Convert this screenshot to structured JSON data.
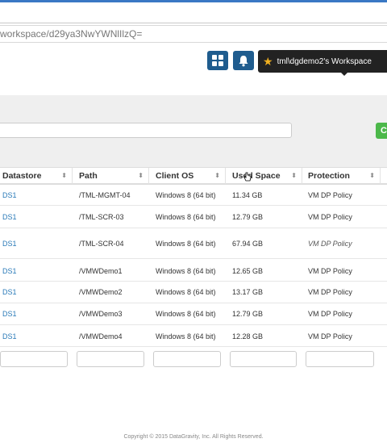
{
  "browser": {
    "url": "workspace/d29ya3NwYWNlIlzQ="
  },
  "header": {
    "workspace_label": "tml\\dgdemo2's Workspace",
    "icons": [
      "grid-icon",
      "bell-icon",
      "star-icon"
    ]
  },
  "toolbar": {
    "green_button_label": "C"
  },
  "table": {
    "columns": [
      "Datastore",
      "Path",
      "Client OS",
      "Used Space",
      "Protection"
    ],
    "rows": [
      {
        "datastore": "DS1",
        "path": "/TML-MGMT-04",
        "os": "Windows 8 (64 bit)",
        "used": "11.34 GB",
        "protection": "VM DP Policy"
      },
      {
        "datastore": "DS1",
        "path": "/TML-SCR-03",
        "os": "Windows 8 (64 bit)",
        "used": "12.79 GB",
        "protection": "VM DP Policy"
      },
      {
        "datastore": "DS1",
        "path": "/TML-SCR-04",
        "os": "Windows 8 (64 bit)",
        "used": "67.94 GB",
        "protection": "VM DP Policy"
      },
      {
        "datastore": "DS1",
        "path": "/VMWDemo1",
        "os": "Windows 8 (64 bit)",
        "used": "12.65 GB",
        "protection": "VM DP Policy"
      },
      {
        "datastore": "DS1",
        "path": "/VMWDemo2",
        "os": "Windows 8 (64 bit)",
        "used": "13.17 GB",
        "protection": "VM DP Policy"
      },
      {
        "datastore": "DS1",
        "path": "/VMWDemo3",
        "os": "Windows 8 (64 bit)",
        "used": "12.79 GB",
        "protection": "VM DP Policy"
      },
      {
        "datastore": "DS1",
        "path": "/VMWDemo4",
        "os": "Windows 8 (64 bit)",
        "used": "12.28 GB",
        "protection": "VM DP Policy"
      }
    ],
    "sort_glyph": "⬍"
  },
  "footer": {
    "copyright": "Copyright © 2015 DataGravity, Inc. All Rights Reserved."
  },
  "colors": {
    "accent": "#1f5c8e",
    "link": "#2a7ab8",
    "success": "#4cb84a"
  }
}
